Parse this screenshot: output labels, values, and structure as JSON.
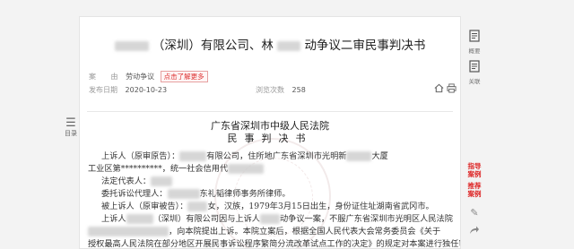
{
  "document": {
    "title_mid": "（深圳）有限公司、林",
    "title_end": "动争议二审民事判决书",
    "meta": {
      "cause_label": "案",
      "cause_label2": "由",
      "cause_value": "劳动争议",
      "tag": "点击了解更多",
      "date_label": "发布日期",
      "date_value": "2020-10-23",
      "views_label": "浏览次数",
      "views_value": "258"
    },
    "court": "广东省深圳市中级人民法院",
    "doc_type": "民事判决书",
    "lines": [
      {
        "a": "上诉人（原审原告）：",
        "b": "有限公司，住所地广东省深圳市光明新",
        "c": "大厦"
      },
      {
        "a": "工业区第**********，统一社会信用代",
        "b": "",
        "c": ""
      },
      {
        "a": "法定代表人：",
        "b": "",
        "c": ""
      },
      {
        "a": "委托诉讼代理人：",
        "b": "东礼韬律师事务所律师。",
        "c": ""
      },
      {
        "a": "被上诉人（原审被告）：",
        "b": "女，汉族，1979年3月15日出生，身份证住址湖南省武冈市。",
        "c": ""
      },
      {
        "a": "上诉人",
        "b": "（深圳）有限公司因与上诉人",
        "c": "动争议一案，不服广东省深圳市光明区人民法院"
      },
      {
        "a": "",
        "b": "，向本院提出上诉。本院立案后，根据全国人民代表大会常务委员会《关于",
        "c": ""
      },
      {
        "a": "授权最高人民法院在部分地区开展民事诉讼程序繁简分流改革试点工作的决定》的规定对本案进行独任审理。",
        "b": "",
        "c": ""
      }
    ]
  },
  "toc": {
    "label": "目录"
  },
  "sidebar": {
    "summary_label": "概要",
    "related_label": "关联",
    "guide_case": "指导案例",
    "recommend_case": "推荐案例"
  },
  "icons": {
    "home": "home-icon",
    "print": "print-icon",
    "toc": "list-icon",
    "summary": "document-icon",
    "related": "document-icon",
    "edit": "edit-icon",
    "share": "share-icon"
  }
}
